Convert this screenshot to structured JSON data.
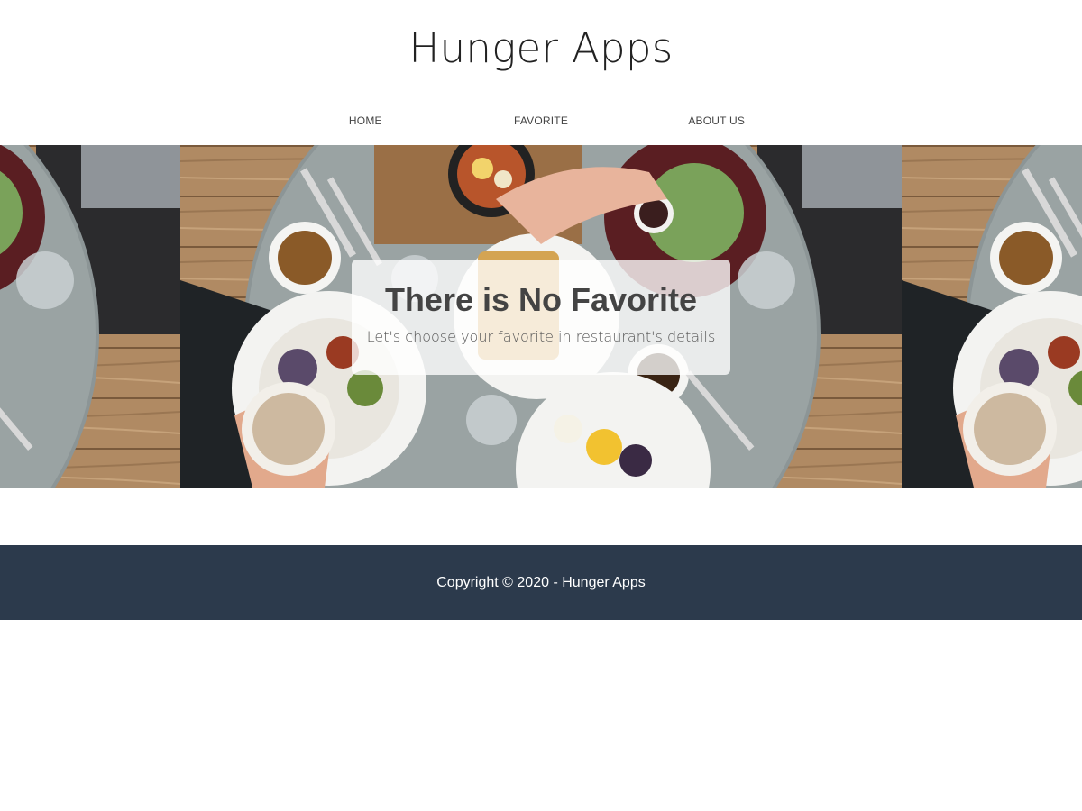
{
  "app": {
    "title": "Hunger Apps"
  },
  "nav": {
    "items": [
      {
        "label": "HOME"
      },
      {
        "label": "FAVORITE"
      },
      {
        "label": "ABOUT US"
      }
    ]
  },
  "hero": {
    "image": "breakfast-table-photo",
    "title": "There is No Favorite",
    "subtitle": "Let's choose your favorite in restaurant's details"
  },
  "footer": {
    "copyright": "Copyright © 2020 - Hunger Apps"
  },
  "colors": {
    "footer_bg": "#2c3a4c",
    "footer_text": "#ffffff",
    "header_bg": "#ffffff",
    "title_text": "#222222"
  }
}
